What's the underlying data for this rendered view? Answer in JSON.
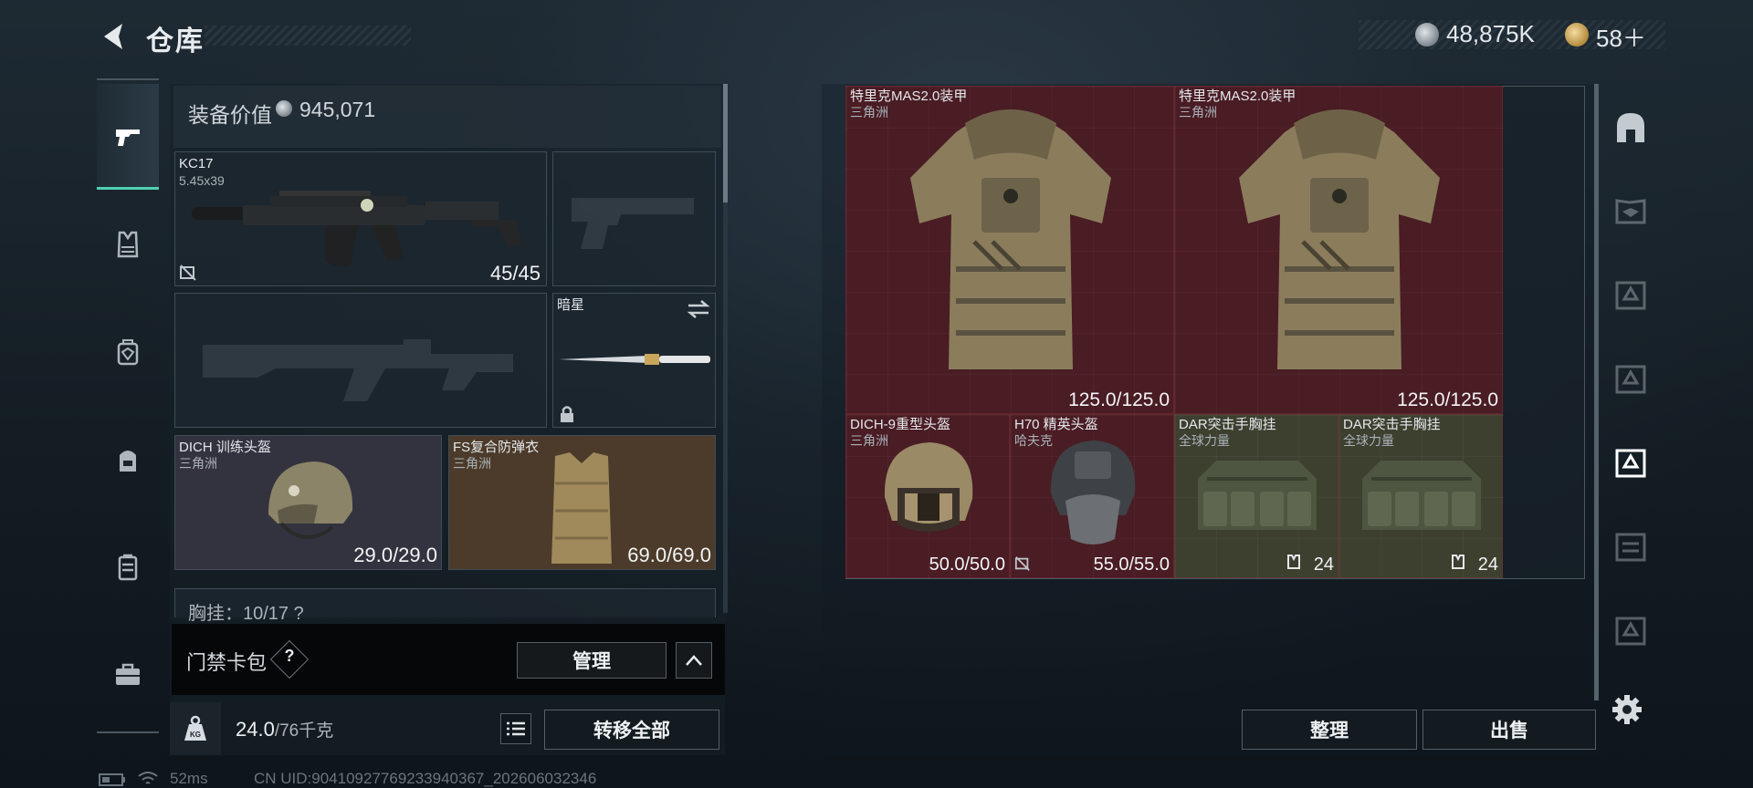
{
  "header": {
    "title": "仓库",
    "silver_amount": "48,875K",
    "gold_amount": "58＋"
  },
  "left_nav": {
    "items": [
      "weapon-icon",
      "vest-icon",
      "backpack-icon",
      "bag-icon",
      "container-icon",
      "case-icon"
    ],
    "active": 0
  },
  "loadout": {
    "value_label": "装备价值",
    "value": "945,071",
    "primary_weapon": {
      "name": "KC17",
      "caliber": "5.45x39",
      "ammo": "45/45"
    },
    "melee": {
      "name": "暗星"
    },
    "helmet": {
      "name": "DICH 训练头盔",
      "faction": "三角洲",
      "durability": "29.0/29.0"
    },
    "armor": {
      "name": "FS复合防弹衣",
      "faction": "三角洲",
      "durability": "69.0/69.0"
    },
    "partial_row_text": "胸挂：10/17 ?"
  },
  "access_card": {
    "label": "门禁卡包",
    "help": "?",
    "manage_label": "管理"
  },
  "weight": {
    "current": "24.0",
    "max": "/76千克",
    "unit_icon": "KG",
    "transfer_label": "转移全部"
  },
  "status_bar": {
    "ping": "52ms",
    "uid": "CN UID:9041092776923394036​7_202606032346"
  },
  "storage": {
    "items": [
      {
        "name": "特里克MAS2.0装甲",
        "faction": "三角洲",
        "value": "125.0/125.0",
        "kind": "armor"
      },
      {
        "name": "特里克MAS2.0装甲",
        "faction": "三角洲",
        "value": "125.0/125.0",
        "kind": "armor"
      },
      {
        "name": "DICH-9重型头盔",
        "faction": "三角洲",
        "value": "50.0/50.0",
        "kind": "helmet"
      },
      {
        "name": "H70 精英头盔",
        "faction": "哈夫克",
        "value": "55.0/55.0",
        "kind": "helmet2"
      },
      {
        "name": "DAR突击手胸挂",
        "faction": "全球力量",
        "value": "24",
        "kind": "rig"
      },
      {
        "name": "DAR突击手胸挂",
        "faction": "全球力量",
        "value": "24",
        "kind": "rig"
      }
    ],
    "sort_label": "整理",
    "sell_label": "出售"
  },
  "colors": {
    "accent": "#4fd0b3",
    "red_cell": "#4a1c24",
    "helmet_cell": "#33333f",
    "armor_cell": "#4c3b2a"
  }
}
